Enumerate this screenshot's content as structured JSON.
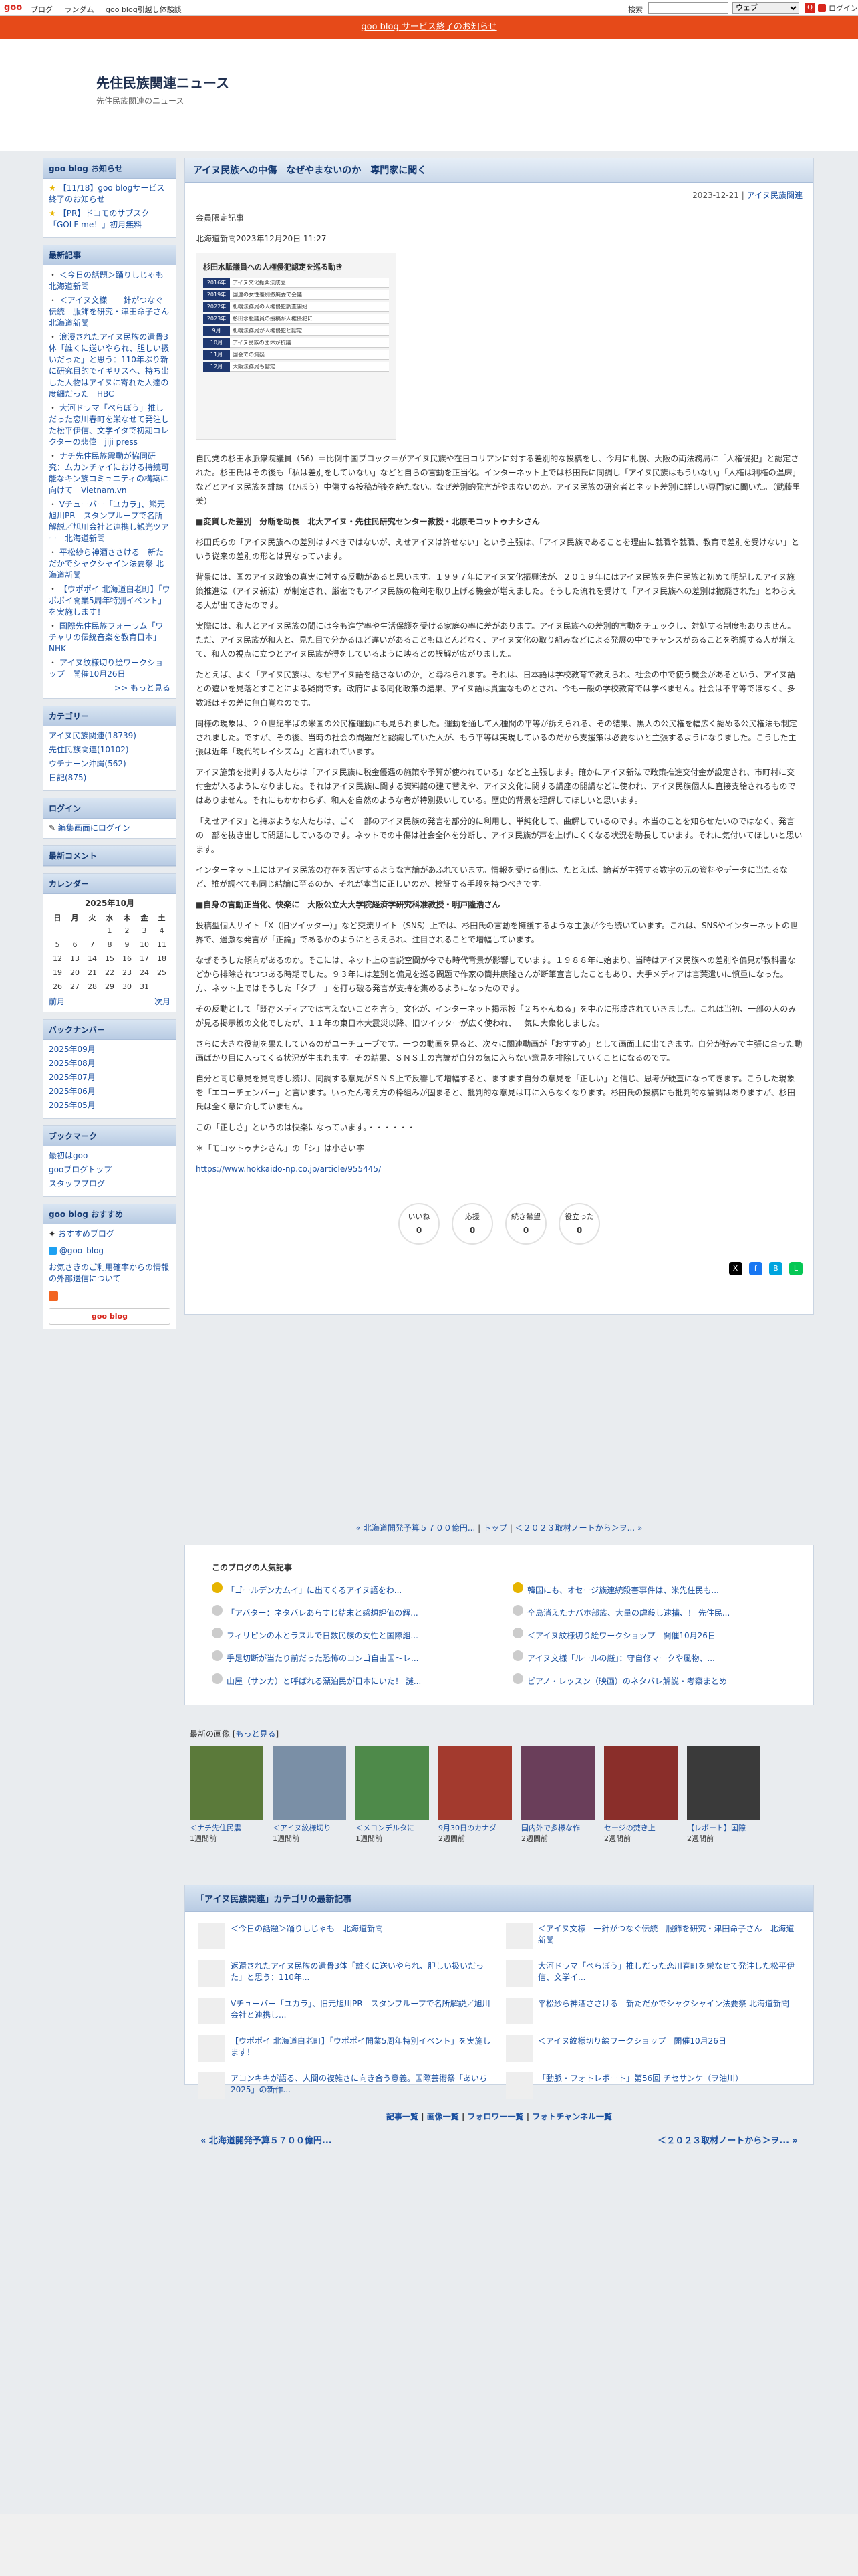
{
  "top_bar": {
    "logo": "goo",
    "nav": [
      "ブログ",
      "ランダム",
      "goo blog引越し体験談"
    ],
    "search_label": "検索",
    "search_select": "ウェブ",
    "login": "ログイン"
  },
  "notice": "goo blog サービス終了のお知らせ",
  "blog": {
    "title": "先住民族関連ニュース",
    "subtitle": "先住民族関連のニュース"
  },
  "sidebar": {
    "notice_head": "goo blog お知らせ",
    "notices": [
      "【11/18】goo blogサービス終了のお知らせ",
      "【PR】ドコモのサブスク「GOLF me！」初月無料"
    ],
    "recent_head": "最新記事",
    "recent": [
      "＜今日の話題＞踊りしじゃも　北海道新聞",
      "＜アイヌ文様　一針がつなぐ伝統　服飾を研究・津田命子さん　北海道新聞",
      "浪漫されたアイヌ民族の遺骨3体「誰くに送いやられ、胆しい扱いだった」と思う：110年ぶり新に研究目的でイギリスへ、持ち出した人物はアイヌに寄れた人達の度細だった　HBC",
      "大河ドラマ「べらぼう」推しだった恋川春町を栄なせて発注した松平伊信、文学イタで初期コレクターの悲偉　jiji press",
      "ナチ先住民族震動が協同研究：ムカンチャイにおける持続可能なキン族コミュニティの構築に向けて　Vietnam.vn",
      "Vチューバー「ユカラ」、熊元旭川PR　スタンプループで名所解説／旭川会社と連携し観光ツアー　北海道新聞",
      "平松紗ら神酒ささける　新ただかでシャクシャイン法要祭 北海道新聞",
      "【ウポポイ 北海道白老町】「ウポポイ開業5周年特別イベント」を実施します！",
      "国際先住民族フォーラム「ワチャリの伝統音楽を教育日本」NHK",
      "アイヌ紋様切り絵ワークショップ　開催10月26日"
    ],
    "more": ">> もっと見る",
    "cat_head": "カテゴリー",
    "categories": [
      "アイヌ民族関連(18739)",
      "先住民族関連(10102)",
      "ウチナーン沖縄(562)",
      "日記(875)"
    ],
    "login_head": "ログイン",
    "login_link": "編集画面にログイン",
    "comment_head": "最新コメント",
    "cal_head": "カレンダー",
    "cal_title": "2025年10月",
    "cal_days": [
      "日",
      "月",
      "火",
      "水",
      "木",
      "金",
      "土"
    ],
    "cal_rows": [
      [
        "",
        "",
        "",
        "1",
        "2",
        "3",
        "4"
      ],
      [
        "5",
        "6",
        "7",
        "8",
        "9",
        "10",
        "11"
      ],
      [
        "12",
        "13",
        "14",
        "15",
        "16",
        "17",
        "18"
      ],
      [
        "19",
        "20",
        "21",
        "22",
        "23",
        "24",
        "25"
      ],
      [
        "26",
        "27",
        "28",
        "29",
        "30",
        "31",
        ""
      ]
    ],
    "cal_prev": "前月",
    "cal_next": "次月",
    "backnum_head": "バックナンバー",
    "backnums": [
      "2025年09月",
      "2025年08月",
      "2025年07月",
      "2025年06月",
      "2025年05月"
    ],
    "bookmark_head": "ブックマーク",
    "bookmarks": [
      "最初はgoo",
      "gooブログトップ",
      "スタッフブログ"
    ],
    "osusume_head": "goo blog おすすめ",
    "osusume": "おすすめブログ",
    "twitter": "@goo_blog",
    "inquiry": "お気さきのご利用確率からの情報の外部送信について",
    "footer_badge": "goo blog"
  },
  "post": {
    "title": "アイヌ民族への中傷　なぜやまないのか　専門家に聞く",
    "date": "2023-12-21",
    "category": "アイヌ民族関連",
    "kicker": "会員限定記事",
    "source": "北海道新聞2023年12月20日 11:27",
    "figure_title": "杉田水脈議員への人権侵犯認定を巡る動き",
    "figure_rows": [
      [
        "2016年",
        "アイヌ文化振興法成立"
      ],
      [
        "2019年",
        "国連の女性差別撤廃委で会議"
      ],
      [
        "2022年",
        "札幌法務局の人権侵犯調査開始"
      ],
      [
        "2023年",
        "杉田水脈議員の投稿が人権侵犯に"
      ],
      [
        "9月",
        "札幌法務局が人権侵犯と認定"
      ],
      [
        "10月",
        "アイヌ民族の団体が抗議"
      ],
      [
        "11月",
        "国会での質疑"
      ],
      [
        "12月",
        "大阪法務局も認定"
      ]
    ],
    "p1": "自民党の杉田水脈衆院議員（56）＝比例中国ブロック＝がアイヌ民族や在日コリアンに対する差別的な投稿をし、今月に札幌、大阪の両法務局に「人権侵犯」と認定された。杉田氏はその後も「私は差別をしていない」などと自らの言動を正当化。インターネット上では杉田氏に同調し「アイヌ民族はもういない」「人権は利権の温床」などとアイヌ民族を誹謗（ひぼう）中傷する投稿が後を絶たない。なぜ差別的発言がやまないのか。アイヌ民族の研究者とネット差別に詳しい専門家に聞いた。（武藤里美）",
    "h1": "■変質した差別　分断を助長　北大アイヌ・先住民研究センター教授・北原モコットゥナシさん",
    "p2": "杉田氏らの「アイヌ民族への差別はすべきではないが、えせアイヌは許せない」という主張は、「アイヌ民族であることを理由に就職や就職、教育で差別を受けない」という従来の差別の形とは異なっています。",
    "p3": "背景には、国のアイヌ政策の真実に対する反動があると思います。１９９７年にアイヌ文化振興法が、２０１９年にはアイヌ民族を先住民族と初めて明記したアイヌ施策推進法（アイヌ新法）が制定され、厳密でもアイヌ民族の権利を取り上げる機会が増えました。そうした流れを受けて「アイヌ民族への差別は撤廃された」とわらえる人が出てきたのです。",
    "p4": "実際には、和人とアイヌ民族の間には今も進学率や生活保護を受ける家庭の率に差があります。アイヌ民族への差別的言動をチェックし、対処する制度もありません。ただ、アイヌ民族が和人と、見た目で分かるほど違いがあることもほとんどなく、アイヌ文化の取り組みなどによる発展の中でチャンスがあることを強調する人が増えて、和人の視点に立つとアイヌ民族が得をしているように映るとの誤解が広がりました。",
    "p5": "たとえば、よく「アイヌ民族は、なぜアイヌ語を話さないのか」と尋ねられます。それは、日本語は学校教育で教えられ、社会の中で使う機会があるという、アイヌ語との違いを見落とすことによる疑問です。政府による同化政策の結果、アイヌ語は貴重なものとされ、今も一般の学校教育では学べません。社会は不平等でほなく、多数派はその差に無自覚なのです。",
    "p6": "同様の現象は、２０世紀半ばの米国の公民権運動にも見られました。運動を通して人種間の平等が訴えられる、その結果、黒人の公民権を幅広く認める公民権法も制定されました。ですが、その後、当時の社会の問題だと認識していた人が、もう平等は実現しているのだから支援策は必要ないと主張するようになりました。こうした主張は近年「現代的レイシズム」と言われています。",
    "p7": "アイヌ施策を批判する人たちは「アイヌ民族に税金優遇の施策や予算が使われている」などと主張します。確かにアイヌ新法で政策推進交付金が設定され、市町村に交付金が入るようになりました。それはアイヌ民族に関する資料館の建て替えや、アイヌ文化に関する講座の開講などに使われ、アイヌ民族個人に直接支給されるものではありません。それにもかかわらず、和人を自然のような者が特別扱いしている。歴史的背景を理解してほしいと思います。",
    "p8": "「えせアイヌ」と持ぶような人たちは、ごく一部のアイヌ民族の発言を部分的に利用し、単純化して、曲解しているのです。本当のことを知らせたいのではなく、発言の一部を抜き出して問題にしているのです。ネットでの中傷は社会全体を分断し、アイヌ民族が声を上げにくくなる状況を助長しています。それに気付いてほしいと思います。",
    "p9": "インターネット上にはアイヌ民族の存在を否定するような言論があふれています。情報を受ける側は、たとえば、論者が主張する数字の元の資料やデータに当たるなど、誰が調べても同じ結論に至るのか、それが本当に正しいのか、検証する手段を持つべきです。",
    "h2": "■自身の言動正当化、快楽に　大阪公立大大学院経済学研究科准教授・明戸隆浩さん",
    "p10": "投稿型個人サイト「X（旧ツイッター）」など交流サイト（SNS）上では、杉田氏の言動を擁護するような主張が今も続いています。これは、SNSやインターネットの世界で、過激な発言が「正論」であるかのようにとらえられ、注目されることで増幅しています。",
    "p11": "なぜそうした傾向があるのか。そこには、ネット上の言説空間が今でも時代背景が影響しています。１９８８年に始まり、当時はアイヌ民族への差別や偏見が教科書などから排除されつつある時期でした。９３年には差別と偏見を巡る問題で作家の筒井康隆さんが断筆宣言したこともあり、大手メディアは言葉遣いに慎重になった。一方、ネット上ではそうした「タブー」を打ち破る発言が支持を集めるようになったのです。",
    "p12": "その反動として「既存メディアでは言えないことを言う」文化が、インターネット掲示板「２ちゃんねる」を中心に形成されていきました。これは当初、一部の人のみが見る掲示板の文化でしたが、１１年の東日本大震災以降、旧ツイッターが広く使われ、一気に大衆化しました。",
    "p13": "さらに大きな役割を果たしているのがユーチューブです。一つの動画を見ると、次々に関連動画が「おすすめ」として画面上に出てきます。自分が好みで主張に合った動画ばかり目に入ってくる状況が生まれます。その結果、ＳＮＳ上の言論が自分の気に入らない意見を排除していくことになるのです。",
    "p14": "自分と同じ意見を見聞きし続け、同調する意見がＳＮＳ上で反響して増幅すると、ますます自分の意見を「正しい」と信じ、思考が硬直になってきます。こうした現象を「エコーチェンバー」と言います。いったん考え方の枠組みが固まると、批判的な意見は耳に入らなくなります。杉田氏の投稿にも批判的な論調はありますが、杉田氏は全く意に介していません。",
    "p15": "この「正しさ」というのは快楽になっています。・・・・・・",
    "note": "＊「モコットゥナシさん」の「シ」は小さい字",
    "link": "https://www.hokkaido-np.co.jp/article/955445/",
    "reactions": [
      {
        "label": "いいね",
        "count": "0"
      },
      {
        "label": "応援",
        "count": "0"
      },
      {
        "label": "続き希望",
        "count": "0"
      },
      {
        "label": "役立った",
        "count": "0"
      }
    ]
  },
  "post_nav": {
    "prev": "« 北海道開発予算５７００億円...",
    "top": "トップ",
    "next": "＜２０２３取材ノートから＞ヲ... »"
  },
  "popular": {
    "head": "このブログの人気記事",
    "items": [
      "「ゴールデンカムイ」に出てくるアイヌ語をわ...",
      "韓国にも、オセージ族連続殺害事件は、米先住民も...",
      "「アバター：ネタバレあらすじ結末と感想評価の解...",
      "全島消えたナバホ部族、大量の虐殺し逮捕、！ 先住民...",
      "フィリピンの木とラスルで日数民族の女性と国際組...",
      "＜アイヌ紋様切り絵ワークショップ　開催10月26日",
      "手足切断が当たり前だった恐怖のコンゴ自由国〜レ...",
      "アイヌ文様「ルールの厳」：守自修マークや風物、...",
      "山屋（サンカ）と呼ばれる漂泊民が日本にいた！ 謎...",
      "ピアノ・レッスン（映画）のネタバレ解説・考察まとめ"
    ]
  },
  "recent_images": {
    "label": "最新の画像",
    "more": "もっと見る",
    "items": [
      {
        "caption": "＜ナチ先住民震",
        "ago": "1週間前",
        "color": "#5b7a3a"
      },
      {
        "caption": "＜アイヌ紋様切り",
        "ago": "1週間前",
        "color": "#7a8fa6"
      },
      {
        "caption": "＜メコンデルタに",
        "ago": "1週間前",
        "color": "#4e8a4a"
      },
      {
        "caption": "9月30日のカナダ",
        "ago": "2週間前",
        "color": "#a33a2e"
      },
      {
        "caption": "国内外で多様な作",
        "ago": "2週間前",
        "color": "#6a3e5a"
      },
      {
        "caption": "セージの焚き上",
        "ago": "2週間前",
        "color": "#8a2e2a"
      },
      {
        "caption": "【レポート】国際",
        "ago": "2週間前",
        "color": "#3a3a3a"
      }
    ]
  },
  "category_box": {
    "head": "「アイヌ民族関連」カテゴリの最新記事",
    "items": [
      "＜今日の話題＞踊りしじゃも　北海道新聞",
      "＜アイヌ文様　一針がつなぐ伝統　服飾を研究・津田命子さん　北海道新聞",
      "返還されたアイヌ民族の遺骨3体「誰くに送いやられ、胆しい扱いだった」と思う：110年...",
      "大河ドラマ「べらぼう」推しだった恋川春町を栄なせて発注した松平伊信、文学イ...",
      "Vチューバー「ユカラ」、旧元旭川PR　スタンプループで名所解説／旭川会社と連携し...",
      "平松紗ら神酒ささける　新ただかでシャクシャイン法要祭 北海道新聞",
      "【ウポポイ 北海道白老町】「ウポポイ開業5周年特別イベント」を実施します！",
      "＜アイヌ紋様切り絵ワークショップ　開催10月26日",
      "アコンキキが語る、人間の複雑さに向き合う意義。国際芸術祭「あいち2025」の新作...",
      "「動脈・フォトレポート」第56回 チセサンケ（ヲ油川）"
    ]
  },
  "footer": {
    "links": [
      "記事一覧",
      "画像一覧",
      "フォロワー一覧",
      "フォトチャンネル一覧"
    ],
    "prev": "« 北海道開発予算５７００億円...",
    "next": "＜２０２３取材ノートから＞ヲ... »"
  },
  "colors": {
    "notice_bar": "#e64a19",
    "header_grad_top": "#d9e5f2",
    "link": "#1a4fa0",
    "accent": "#d7261d"
  }
}
